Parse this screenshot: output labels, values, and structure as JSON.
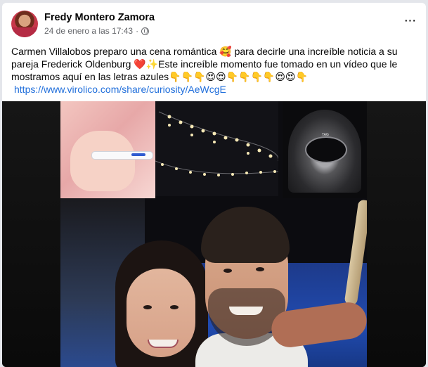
{
  "post": {
    "author": "Fredy Montero Zamora",
    "timestamp": "24 de enero a las 17:43",
    "separator": "·",
    "privacy_icon": "globe-icon",
    "more_icon": "more-horizontal-icon",
    "more_label": "···",
    "text_line1": "Carmen Villalobos preparo una cena romántica 🥰 para decirle una increíble noticia a su pareja Frederick Oldenburg ❤️✨Este increíble momento fue tomado en un vídeo que le mostramos aquí en las letras azules👇👇👇😍😍👇👇👇👇😍😍👇",
    "link": "https://www.virolico.com/share/curiosity/AeWcgE",
    "image_label": "TAG"
  },
  "colors": {
    "link": "#216fdb",
    "author_text": "#050505",
    "meta_text": "#65676b",
    "card_bg": "#ffffff",
    "page_bg": "#e4e6eb"
  }
}
